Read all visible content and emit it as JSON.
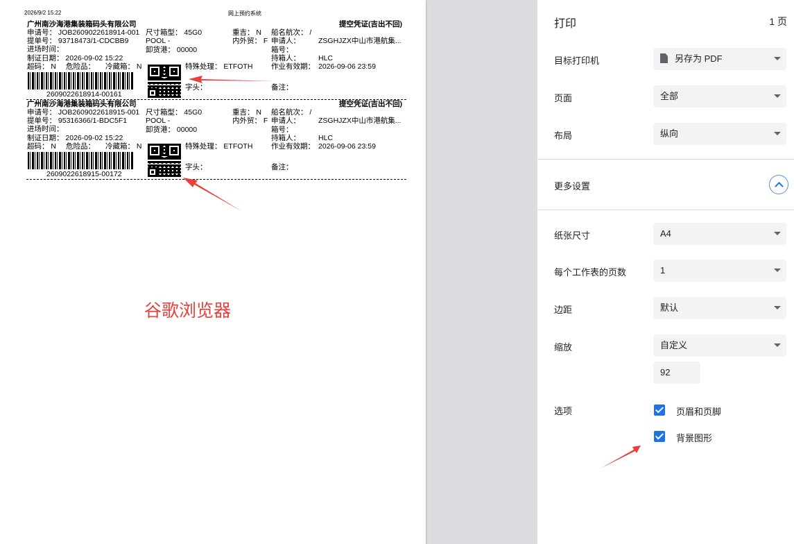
{
  "print_preview": {
    "header_datetime": "2026/9/2 15:22",
    "header_system": "网上预约系统",
    "watermark_text": "谷歌浏览器",
    "cards": [
      {
        "company": "广州南沙海港集装箱码头有限公司",
        "title": "提空凭证(吉出不回)",
        "app_no": "申请号：  JOB2609022618914-001",
        "size_type": "尺寸箱型：  45G0",
        "heavy": "重吉：  N",
        "vessel": "船名航次：     /",
        "bl_no": "提单号：  93718473/1-CDCBB9",
        "pool": "POOL -",
        "trade": "内外贸：  F",
        "applicant_label": "申请人：",
        "applicant": "ZSGHJZX中山市港航集...",
        "entry_time": "进场时间：",
        "discharge": "卸货港：   00000",
        "box_no": "箱号：",
        "issue_date": "制证日期：    2026-09-02 15:22",
        "holder_label": "持箱人：",
        "holder": "HLC",
        "overlimit": "超码：   N",
        "dangerous": "危险品：",
        "reefer": "冷藏箱：  N",
        "special": "特殊处理：   ETFOTH",
        "validity_label": "作业有效期：",
        "validity": "2026-09-06 23:59",
        "head": "字头：",
        "remark": "备注：",
        "barcode_text": "2609022618914-00161"
      },
      {
        "company": "广州南沙海港集装箱码头有限公司",
        "title": "提空凭证(吉出不回)",
        "app_no": "申请号：  JOB2609022618915-001",
        "size_type": "尺寸箱型：  45G0",
        "heavy": "重吉：  N",
        "vessel": "船名航次：     /",
        "bl_no": "提单号：  95316366/1-BDC5F1",
        "pool": "POOL -",
        "trade": "内外贸：  F",
        "applicant_label": "申请人：",
        "applicant": "ZSGHJZX中山市港航集...",
        "entry_time": "进场时间：",
        "discharge": "卸货港：   00000",
        "box_no": "箱号：",
        "issue_date": "制证日期：    2026-09-02 15:22",
        "holder_label": "持箱人：",
        "holder": "HLC",
        "overlimit": "超码：   N",
        "dangerous": "危险品：",
        "reefer": "冷藏箱：  N",
        "special": "特殊处理：   ETFOTH",
        "validity_label": "作业有效期：",
        "validity": "2026-09-06 23:59",
        "head": "字头：",
        "remark": "备注：",
        "barcode_text": "2609022618915-00172"
      }
    ]
  },
  "settings": {
    "title": "打印",
    "page_count": "1 页",
    "destination_label": "目标打印机",
    "destination_value": "另存为 PDF",
    "pages_label": "页面",
    "pages_value": "全部",
    "layout_label": "布局",
    "layout_value": "纵向",
    "more_settings_label": "更多设置",
    "paper_size_label": "纸张尺寸",
    "paper_size_value": "A4",
    "pages_per_sheet_label": "每个工作表的页数",
    "pages_per_sheet_value": "1",
    "margins_label": "边距",
    "margins_value": "默认",
    "scale_label": "缩放",
    "scale_value": "自定义",
    "scale_number": "92",
    "options_label": "选项",
    "option_headers_footers": "页眉和页脚",
    "option_headers_footers_checked": true,
    "option_background": "背景图形",
    "option_background_checked": true
  },
  "colors": {
    "accent": "#1a73e8",
    "annotation_red": "#e8413c",
    "select_bg": "#f1f3f4"
  }
}
